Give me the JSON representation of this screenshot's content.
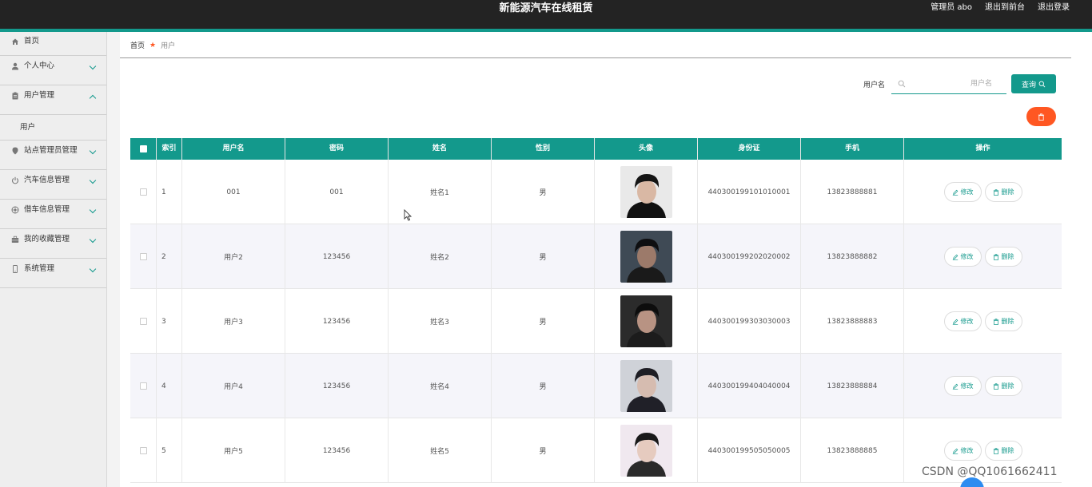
{
  "header": {
    "title": "新能源汽车在线租赁",
    "admin_label": "管理员 abo",
    "exit_front": "退出到前台",
    "logout": "退出登录"
  },
  "sidebar": {
    "items": [
      {
        "label": "首页",
        "icon": "home-icon"
      },
      {
        "label": "个人中心",
        "icon": "user-icon"
      },
      {
        "label": "用户管理",
        "icon": "clipboard-icon",
        "expanded": true,
        "children": [
          {
            "label": "用户"
          }
        ]
      },
      {
        "label": "站点管理员管理",
        "icon": "location-icon"
      },
      {
        "label": "汽车信息管理",
        "icon": "power-icon"
      },
      {
        "label": "借车信息管理",
        "icon": "wheel-icon"
      },
      {
        "label": "我的收藏管理",
        "icon": "briefcase-icon"
      },
      {
        "label": "系统管理",
        "icon": "phone-icon"
      }
    ]
  },
  "breadcrumb": {
    "home": "首页",
    "current": "用户"
  },
  "search": {
    "label": "用户名",
    "placeholder": "用户名",
    "button": "查询"
  },
  "table": {
    "headers": [
      "索引",
      "用户名",
      "密码",
      "姓名",
      "性别",
      "头像",
      "身份证",
      "手机",
      "操作"
    ],
    "edit_label": "修改",
    "delete_label": "删除",
    "rows": [
      {
        "index": "1",
        "username": "001",
        "password": "001",
        "name": "姓名1",
        "gender": "男",
        "id_card": "440300199101010001",
        "phone": "13823888881"
      },
      {
        "index": "2",
        "username": "用户2",
        "password": "123456",
        "name": "姓名2",
        "gender": "男",
        "id_card": "440300199202020002",
        "phone": "13823888882"
      },
      {
        "index": "3",
        "username": "用户3",
        "password": "123456",
        "name": "姓名3",
        "gender": "男",
        "id_card": "440300199303030003",
        "phone": "13823888883"
      },
      {
        "index": "4",
        "username": "用户4",
        "password": "123456",
        "name": "姓名4",
        "gender": "男",
        "id_card": "440300199404040004",
        "phone": "13823888884"
      },
      {
        "index": "5",
        "username": "用户5",
        "password": "123456",
        "name": "姓名5",
        "gender": "男",
        "id_card": "440300199505050005",
        "phone": "13823888885"
      }
    ]
  },
  "watermark": "CSDN @QQ1061662411",
  "colors": {
    "accent": "#13998c",
    "header": "#232323",
    "danger": "#ff5722"
  }
}
